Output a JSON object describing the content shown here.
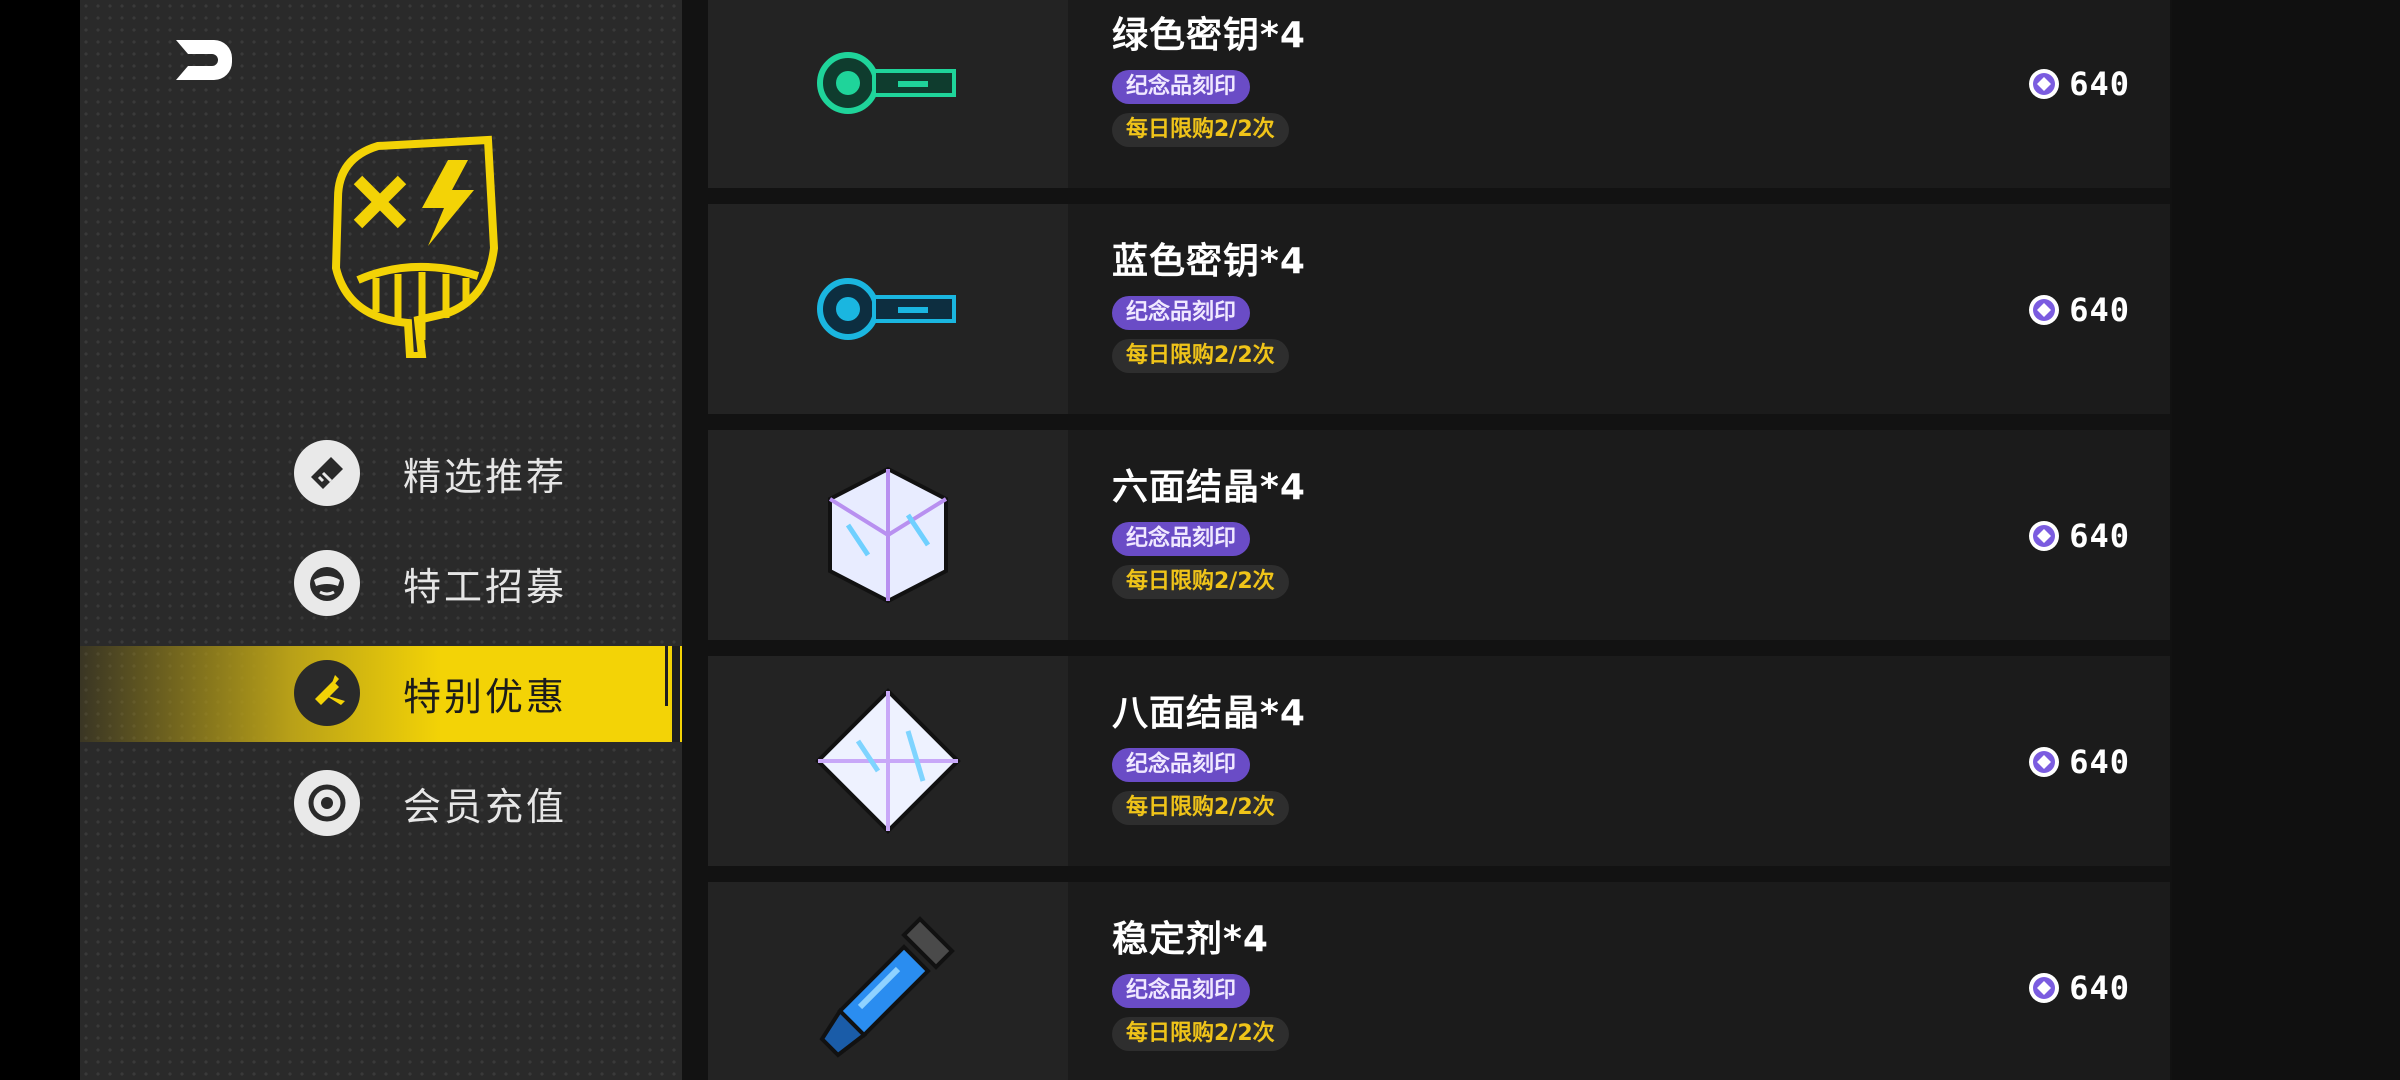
{
  "sidebar": {
    "items": [
      {
        "label": "精选推荐",
        "icon": "ticket-icon"
      },
      {
        "label": "特工招募",
        "icon": "agent-mask-icon"
      },
      {
        "label": "特别优惠",
        "icon": "bolt-icon",
        "active": true
      },
      {
        "label": "会员充值",
        "icon": "membership-icon"
      }
    ]
  },
  "products": [
    {
      "title": "绿色密钥*4",
      "souvenir": "纪念品刻印",
      "limit": "每日限购2/2次",
      "price": "640",
      "icon": "green-key-icon"
    },
    {
      "title": "蓝色密钥*4",
      "souvenir": "纪念品刻印",
      "limit": "每日限购2/2次",
      "price": "640",
      "icon": "blue-key-icon"
    },
    {
      "title": "六面结晶*4",
      "souvenir": "纪念品刻印",
      "limit": "每日限购2/2次",
      "price": "640",
      "icon": "hexahedron-crystal-icon"
    },
    {
      "title": "八面结晶*4",
      "souvenir": "纪念品刻印",
      "limit": "每日限购2/2次",
      "price": "640",
      "icon": "octahedron-crystal-icon"
    },
    {
      "title": "稳定剂*4",
      "souvenir": "纪念品刻印",
      "limit": "每日限购2/2次",
      "price": "640",
      "icon": "stabilizer-icon"
    }
  ],
  "colors": {
    "accent": "#f3d306",
    "souvenir_badge": "#6a4cc6",
    "limit_text": "#f0c419"
  }
}
